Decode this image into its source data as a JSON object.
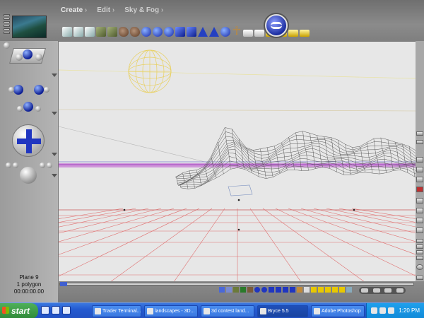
{
  "menu": {
    "create": "Create",
    "edit": "Edit",
    "sky_fog": "Sky & Fog"
  },
  "status": {
    "object_name": "Plane 9",
    "polygon_count": "1 polygon",
    "timecode": "00:00:00.00"
  },
  "taskbar": {
    "start": "start",
    "tasks": [
      "Trader Terminal...",
      "landscapes - 3D...",
      "3d contest land...",
      "Bryce 5.5",
      "Adobe Photoshop"
    ],
    "clock": "1:20 PM"
  },
  "colors": {
    "grid": "#e07070",
    "horizon": "#c060d0",
    "terrain": "#555555",
    "sun": "#e8d060",
    "accent": "#2036c0"
  },
  "icons": {
    "tools": [
      "terrain-icon",
      "rock-icon",
      "sphere-icon",
      "cube-icon",
      "cone-icon",
      "figure-icon"
    ],
    "logo": "bryce-logo-icon"
  }
}
